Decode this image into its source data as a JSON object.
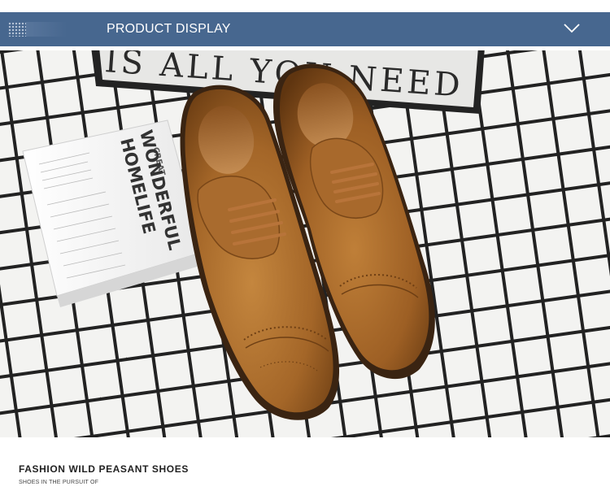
{
  "header": {
    "title": "PRODUCT DISPLAY",
    "grip_icon": "dots-grid-icon",
    "toggle_icon": "chevron-down-icon",
    "background_color": "#47678f"
  },
  "photo": {
    "sign_text": "IS ALL YOU NEED",
    "book_title_line1": "WONDERFUL",
    "book_title_line2": "HOMELIFE",
    "book_small_label": "CREAT",
    "shoe_color": "#a86a2a",
    "tile_grid_color": "#1e1e1e"
  },
  "caption": {
    "title": "FASHION WILD PEASANT SHOES",
    "subtitle": "SHOES IN THE PURSUIT OF"
  }
}
